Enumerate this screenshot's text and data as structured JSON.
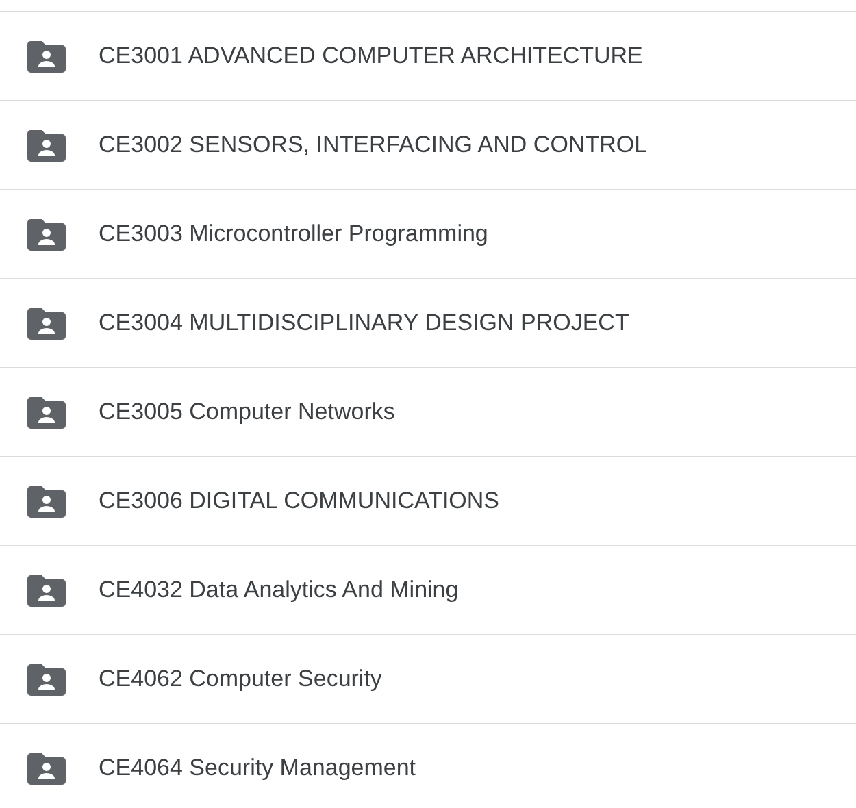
{
  "folders": [
    {
      "name": "CE3001 ADVANCED COMPUTER ARCHITECTURE"
    },
    {
      "name": "CE3002 SENSORS, INTERFACING AND CONTROL"
    },
    {
      "name": "CE3003 Microcontroller Programming"
    },
    {
      "name": "CE3004 MULTIDISCIPLINARY DESIGN PROJECT"
    },
    {
      "name": "CE3005 Computer Networks"
    },
    {
      "name": "CE3006 DIGITAL COMMUNICATIONS"
    },
    {
      "name": "CE4032 Data Analytics And Mining"
    },
    {
      "name": "CE4062 Computer Security"
    },
    {
      "name": "CE4064 Security Management"
    }
  ]
}
